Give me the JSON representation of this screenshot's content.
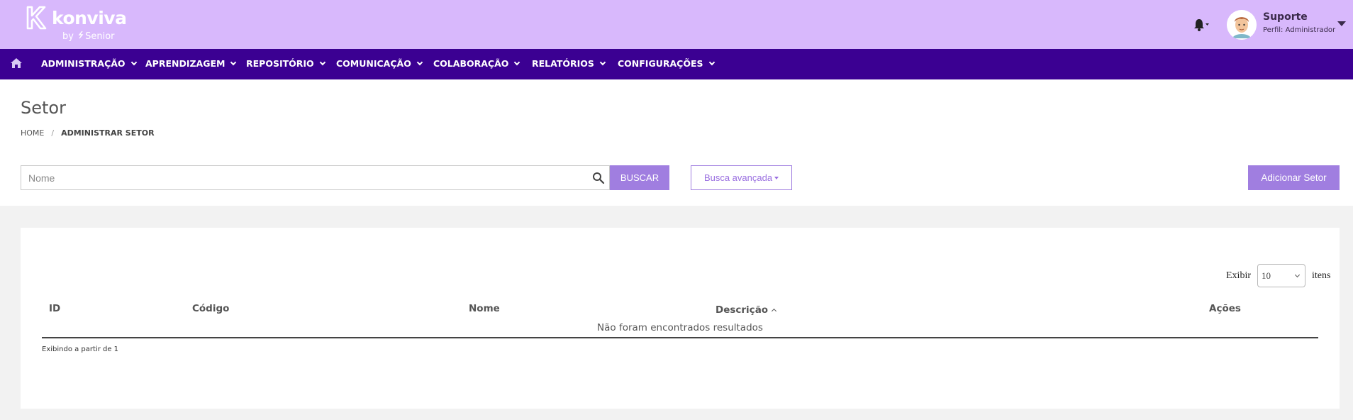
{
  "brand": {
    "name": "konviva",
    "byline_prefix": "by",
    "byline_company": "Senior"
  },
  "user": {
    "name": "Suporte",
    "profile": "Perfil: Administrador"
  },
  "nav": {
    "items": [
      {
        "label": "ADMINISTRAÇÃO"
      },
      {
        "label": "APRENDIZAGEM"
      },
      {
        "label": "REPOSITÓRIO"
      },
      {
        "label": "COMUNICAÇÃO"
      },
      {
        "label": "COLABORAÇÃO"
      },
      {
        "label": "RELATÓRIOS"
      },
      {
        "label": "CONFIGURAÇÕES"
      }
    ]
  },
  "page": {
    "title": "Setor",
    "breadcrumb": {
      "home": "HOME",
      "separator": "/",
      "current": "ADMINISTRAR SETOR"
    }
  },
  "search": {
    "placeholder": "Nome",
    "value": "",
    "button_label": "BUSCAR",
    "advanced_label": "Busca avançada",
    "add_label": "Adicionar Setor"
  },
  "table": {
    "show_label": "Exibir",
    "page_size": "10",
    "items_label": "itens",
    "columns": [
      {
        "label": "ID"
      },
      {
        "label": "Código"
      },
      {
        "label": "Nome"
      },
      {
        "label": "Descrição"
      },
      {
        "label": "Ações"
      }
    ],
    "sorted_column": "Descrição",
    "sort_direction": "asc",
    "empty_message": "Não foram encontrados resultados",
    "footer": "Exibindo a partir de 1"
  },
  "colors": {
    "header_bg": "#d8b8fc",
    "nav_bg": "#3b0092",
    "accent": "#a07ee0"
  }
}
